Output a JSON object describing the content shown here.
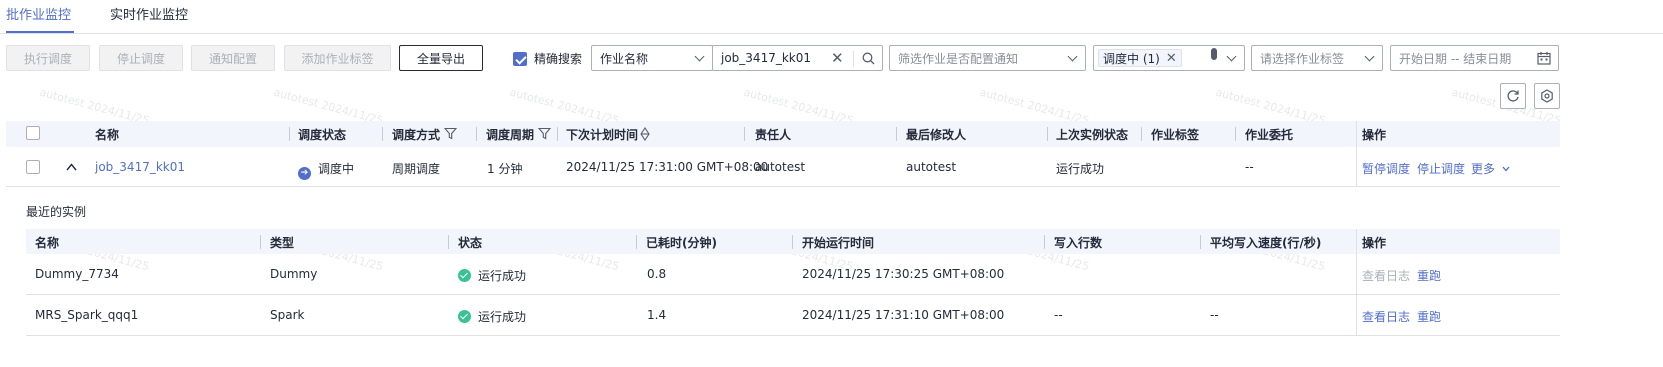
{
  "tabs": [
    {
      "label": "批作业监控",
      "active": true
    },
    {
      "label": "实时作业监控",
      "active": false
    }
  ],
  "toolbar": {
    "buttons": [
      "执行调度",
      "停止调度",
      "通知配置",
      "添加作业标签"
    ],
    "export_label": "全量导出",
    "exact_search_label": "精确搜索",
    "exact_search_checked": true,
    "search_field_select": "作业名称",
    "search_value": "job_3417_kk01",
    "notify_filter_placeholder": "筛选作业是否配置通知",
    "status_tag": "调度中 (1)",
    "tag_filter_placeholder": "请选择作业标签",
    "date_range_placeholder": "开始日期 -- 结束日期"
  },
  "watermark": "autotest 2024/11/25",
  "jobs_table": {
    "headers": [
      "名称",
      "调度状态",
      "调度方式",
      "调度周期",
      "下次计划时间",
      "责任人",
      "最后修改人",
      "上次实例状态",
      "作业标签",
      "作业委托",
      "操作"
    ],
    "rows": [
      {
        "name": "job_3417_kk01",
        "schedule_status": "调度中",
        "schedule_mode": "周期调度",
        "cycle": "1 分钟",
        "next_time": "2024/11/25 17:31:00 GMT+08:00",
        "owner": "autotest",
        "last_modifier": "autotest",
        "last_instance_status": "运行成功",
        "tags": "",
        "delegation": "--",
        "actions": [
          "暂停调度",
          "停止调度",
          "更多"
        ]
      }
    ]
  },
  "instances": {
    "title": "最近的实例",
    "headers": [
      "名称",
      "类型",
      "状态",
      "已耗时(分钟)",
      "开始运行时间",
      "写入行数",
      "平均写入速度(行/秒)",
      "操作"
    ],
    "rows": [
      {
        "name": "Dummy_7734",
        "type": "Dummy",
        "status": "运行成功",
        "elapsed": "0.8",
        "start": "2024/11/25 17:30:25 GMT+08:00",
        "rows_written": "",
        "avg_speed": "",
        "actions": [
          "查看日志",
          "重跑"
        ],
        "log_enabled": false
      },
      {
        "name": "MRS_Spark_qqq1",
        "type": "Spark",
        "status": "运行成功",
        "elapsed": "1.4",
        "start": "2024/11/25 17:31:10 GMT+08:00",
        "rows_written": "--",
        "avg_speed": "--",
        "actions": [
          "查看日志",
          "重跑"
        ],
        "log_enabled": true
      }
    ]
  }
}
